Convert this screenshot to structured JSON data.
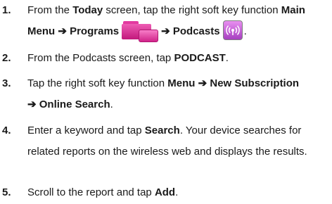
{
  "steps": [
    {
      "num": "1.",
      "t1": "From the ",
      "b1": "Today",
      "t2": " screen, tap the right soft key function ",
      "b2": "Main Menu",
      "b3": "Programs",
      "b4": "Podcasts",
      "t_end": ".",
      "arrow": "➔",
      "icons": [
        "programs-folder-icon",
        "podcasts-icon"
      ]
    },
    {
      "num": "2.",
      "t1": "From the Podcasts screen, tap ",
      "b1": "PODCAST",
      "t_end": "."
    },
    {
      "num": "3.",
      "t1": "Tap the right soft key function ",
      "b1": "Menu",
      "b2": "New Subscription",
      "b3": "Online Search",
      "t_end": ".",
      "arrow": "➔"
    },
    {
      "num": "4.",
      "t1": "Enter a keyword and tap ",
      "b1": "Search",
      "t2": ". Your device searches for related reports on the wireless web and displays the results."
    },
    {
      "num": "5.",
      "t1": "Scroll to the report and tap ",
      "b1": "Add",
      "t_end": "."
    }
  ],
  "colors": {
    "programs_icon": "#e33aa0",
    "podcasts_icon": "#b84fd0"
  }
}
